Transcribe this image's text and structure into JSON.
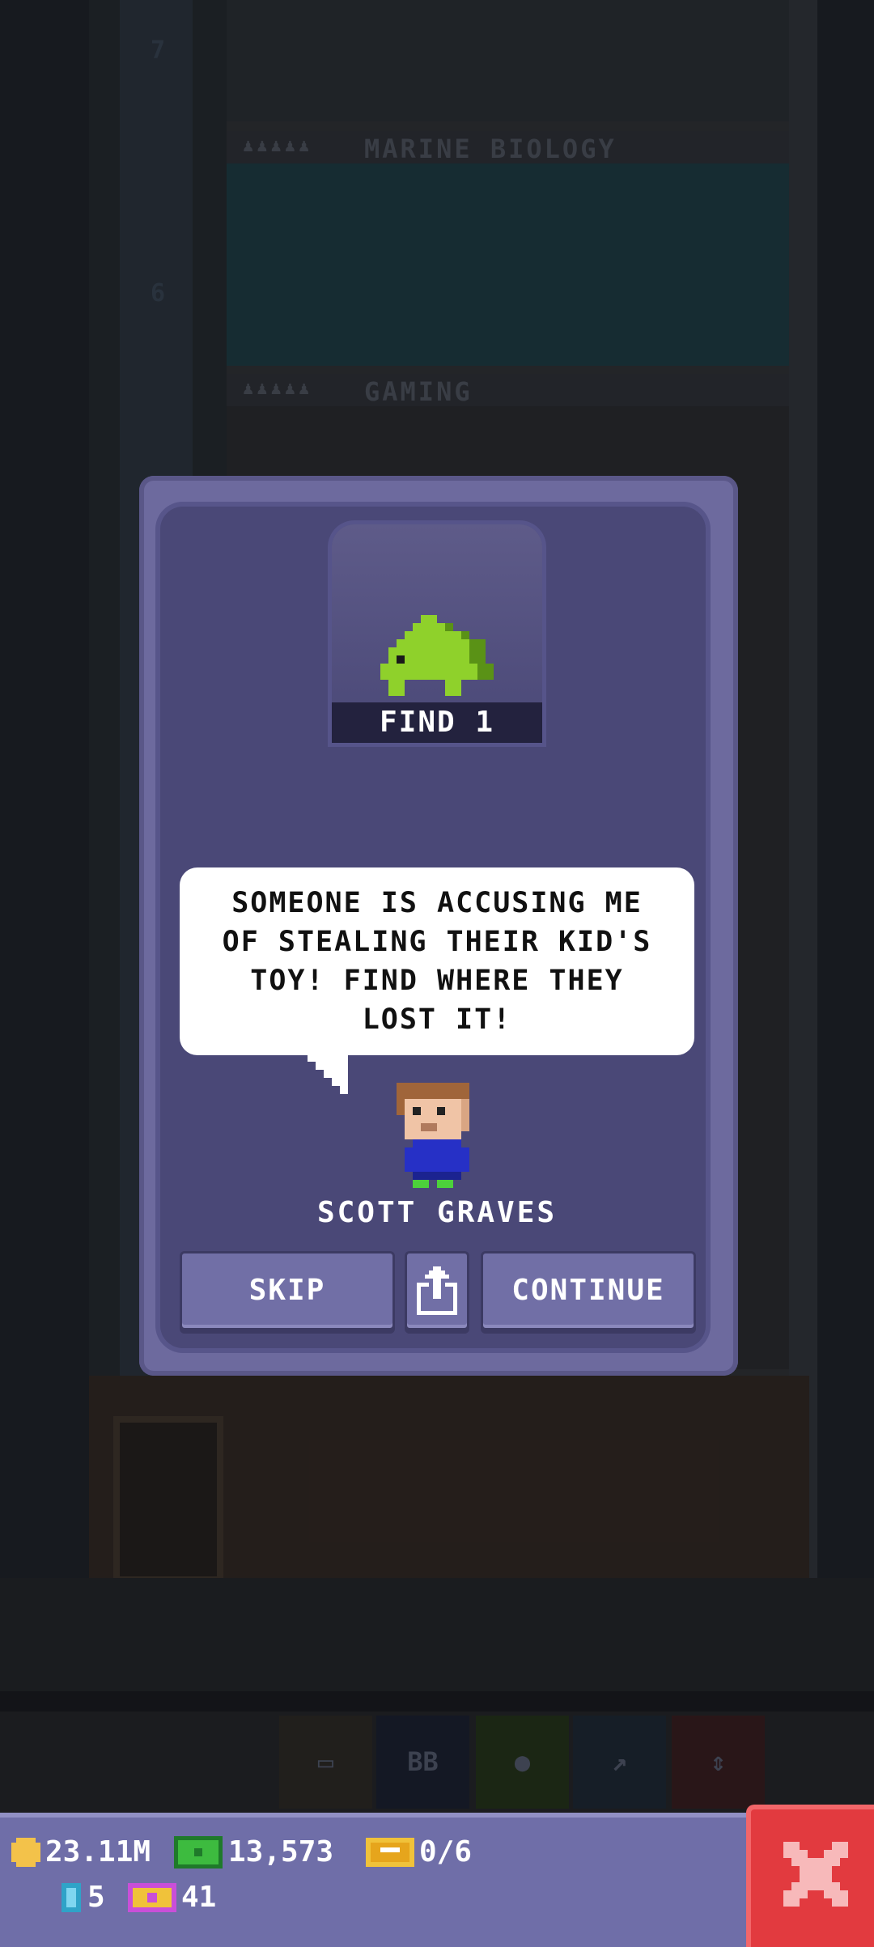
{
  "background": {
    "floors": [
      {
        "number": "7",
        "room": ""
      },
      {
        "number": "6",
        "room": "MARINE BIOLOGY"
      },
      {
        "number": "",
        "room": "GAMING"
      }
    ],
    "people_icons": "♟♟♟♟♟",
    "toolbar": {
      "bb_label": "BB"
    }
  },
  "mission": {
    "goal_label": "FIND 1",
    "item_icon": "green-stegosaurus-toy-icon",
    "message": "SOMEONE IS ACCUSING ME OF STEALING THEIR KID'S TOY! FIND WHERE THEY LOST IT!",
    "npc_name": "SCOTT GRAVES",
    "buttons": {
      "skip": "SKIP",
      "share_icon": "share-icon",
      "continue": "CONTINUE"
    }
  },
  "hud": {
    "coins": "23.11M",
    "bux": "13,573",
    "tickets": "0/6",
    "keys": "5",
    "golden_tickets": "41"
  },
  "colors": {
    "modal": "#4a4877",
    "button": "#716fa6",
    "close": "#e23a3f",
    "dino": "#8fd12b"
  }
}
